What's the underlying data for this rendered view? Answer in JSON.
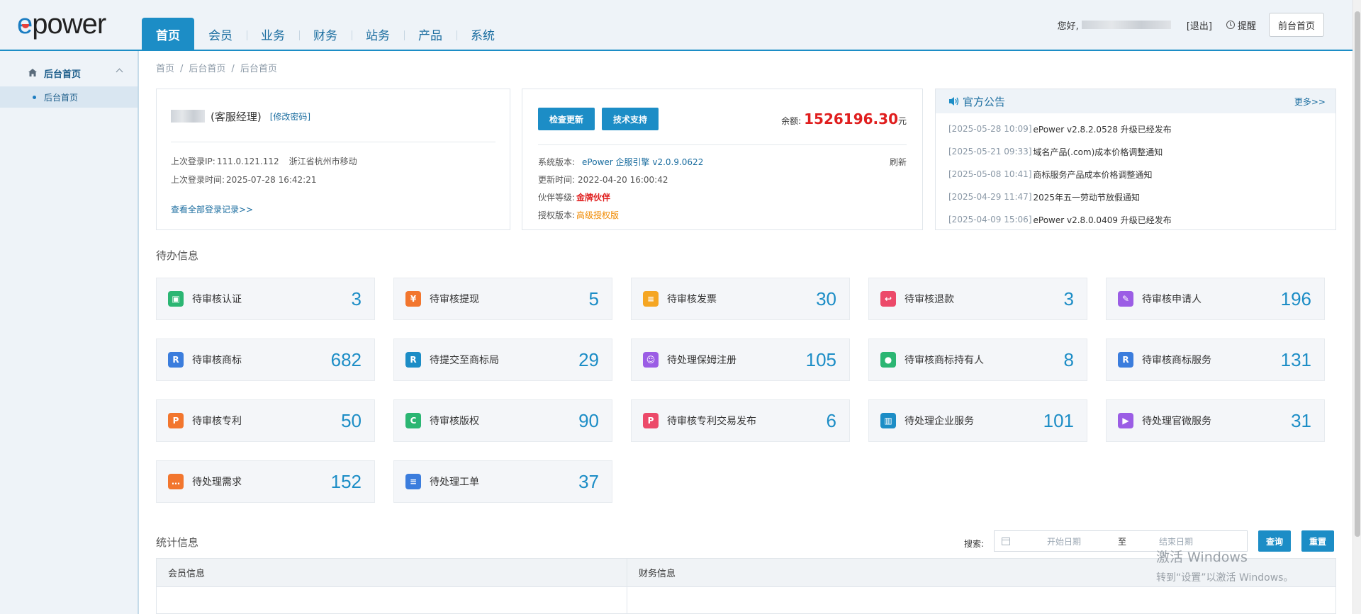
{
  "brand": {
    "logo_e": "e",
    "logo_rest": "power"
  },
  "nav": {
    "items": [
      {
        "label": "首页",
        "active": true
      },
      {
        "label": "会员"
      },
      {
        "label": "业务"
      },
      {
        "label": "财务"
      },
      {
        "label": "站务"
      },
      {
        "label": "产品"
      },
      {
        "label": "系统"
      }
    ]
  },
  "user": {
    "greeting": "您好,",
    "logout": "[退出]",
    "remind": "提醒",
    "front_home": "前台首页"
  },
  "sidebar": {
    "group_label": "后台首页",
    "items": [
      {
        "label": "后台首页"
      }
    ]
  },
  "breadcrumb": [
    "首页",
    "后台首页",
    "后台首页"
  ],
  "account": {
    "role": "(客服经理)",
    "change_password": "[修改密码]",
    "last_ip_label": "上次登录IP:",
    "last_ip": "111.0.121.112",
    "location": "浙江省杭州市移动",
    "last_time_label": "上次登录时间:",
    "last_time": "2025-07-28 16:42:21",
    "all_logs": "查看全部登录记录>>"
  },
  "system": {
    "check_update": "检查更新",
    "tech_support": "技术支持",
    "balance_label": "余额:",
    "balance": "1526196.30",
    "balance_unit": "元",
    "version_label": "系统版本:",
    "version": "ePower 企服引擎 v2.0.9.0622",
    "refresh": "刷新",
    "update_time_label": "更新时间:",
    "update_time": "2022-04-20 16:00:42",
    "partner_label": "伙伴等级:",
    "partner": "金牌伙伴",
    "license_label": "授权版本:",
    "license": "高级授权版"
  },
  "announcements": {
    "title": "官方公告",
    "more": "更多>>",
    "items": [
      {
        "date": "[2025-05-28 10:09]",
        "text": "ePower v2.8.2.0528 升级已经发布"
      },
      {
        "date": "[2025-05-21 09:33]",
        "text": "域名产品(.com)成本价格调整通知"
      },
      {
        "date": "[2025-05-08 10:41]",
        "text": "商标服务产品成本价格调整通知"
      },
      {
        "date": "[2025-04-29 11:47]",
        "text": "2025年五一劳动节放假通知"
      },
      {
        "date": "[2025-04-09 15:06]",
        "text": "ePower v2.8.0.0409 升级已经发布"
      }
    ]
  },
  "todo": {
    "title": "待办信息",
    "items": [
      {
        "label": "待审核认证",
        "count": "3",
        "icon": "id-card-icon",
        "color": "#2bb673",
        "glyph": "▣"
      },
      {
        "label": "待审核提现",
        "count": "5",
        "icon": "withdraw-house-icon",
        "color": "#f2762e",
        "glyph": "¥"
      },
      {
        "label": "待审核发票",
        "count": "30",
        "icon": "invoice-icon",
        "color": "#f5a623",
        "glyph": "≡"
      },
      {
        "label": "待审核退款",
        "count": "3",
        "icon": "refund-card-icon",
        "color": "#ec4a6a",
        "glyph": "↩"
      },
      {
        "label": "待审核申请人",
        "count": "196",
        "icon": "applicant-edit-icon",
        "color": "#9b5de5",
        "glyph": "✎"
      },
      {
        "label": "待审核商标",
        "count": "682",
        "icon": "trademark-r-icon",
        "color": "#3b7ddd",
        "glyph": "R"
      },
      {
        "label": "待提交至商标局",
        "count": "29",
        "icon": "trademark-office-icon",
        "color": "#1c8dc6",
        "glyph": "R"
      },
      {
        "label": "待处理保姆注册",
        "count": "105",
        "icon": "nanny-register-icon",
        "color": "#9b5de5",
        "glyph": "☺"
      },
      {
        "label": "待审核商标持有人",
        "count": "8",
        "icon": "holder-user-icon",
        "color": "#2bb673",
        "glyph": "●"
      },
      {
        "label": "待审核商标服务",
        "count": "131",
        "icon": "trademark-service-icon",
        "color": "#3b7ddd",
        "glyph": "R"
      },
      {
        "label": "待审核专利",
        "count": "50",
        "icon": "patent-p-icon",
        "color": "#f2762e",
        "glyph": "P"
      },
      {
        "label": "待审核版权",
        "count": "90",
        "icon": "copyright-c-icon",
        "color": "#2bb673",
        "glyph": "C"
      },
      {
        "label": "待审核专利交易发布",
        "count": "6",
        "icon": "patent-trade-icon",
        "color": "#ec4a6a",
        "glyph": "P"
      },
      {
        "label": "待处理企业服务",
        "count": "101",
        "icon": "enterprise-building-icon",
        "color": "#1c8dc6",
        "glyph": "▥"
      },
      {
        "label": "待处理官微服务",
        "count": "31",
        "icon": "official-wechat-icon",
        "color": "#9b5de5",
        "glyph": "▶"
      },
      {
        "label": "待处理需求",
        "count": "152",
        "icon": "demand-chat-icon",
        "color": "#f2762e",
        "glyph": "…"
      },
      {
        "label": "待处理工单",
        "count": "37",
        "icon": "work-order-icon",
        "color": "#3b7ddd",
        "glyph": "≡"
      }
    ]
  },
  "stats": {
    "title": "统计信息",
    "search_label": "搜索:",
    "start_placeholder": "开始日期",
    "to": "至",
    "end_placeholder": "结束日期",
    "query": "查询",
    "reset": "重置",
    "col_member": "会员信息",
    "col_finance": "财务信息"
  },
  "watermark": {
    "line1": "激活 Windows",
    "line2": "转到“设置”以激活 Windows。"
  },
  "colors": {
    "primary": "#1c8dc6",
    "balance": "#e01e1e",
    "license": "#f08a00"
  }
}
